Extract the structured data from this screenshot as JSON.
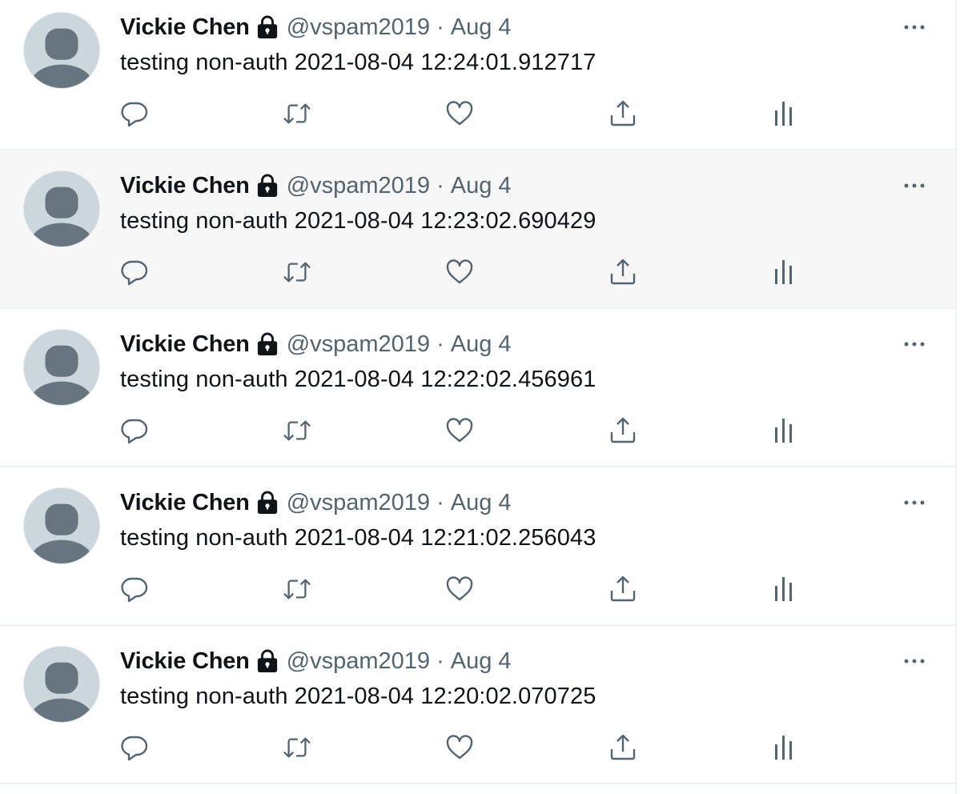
{
  "tweets": [
    {
      "name": "Vickie Chen",
      "handle": "@vspam2019",
      "separator": "·",
      "date": "Aug 4",
      "text": "testing non-auth 2021-08-04 12:24:01.912717",
      "hovered": false
    },
    {
      "name": "Vickie Chen",
      "handle": "@vspam2019",
      "separator": "·",
      "date": "Aug 4",
      "text": "testing non-auth 2021-08-04 12:23:02.690429",
      "hovered": true
    },
    {
      "name": "Vickie Chen",
      "handle": "@vspam2019",
      "separator": "·",
      "date": "Aug 4",
      "text": "testing non-auth 2021-08-04 12:22:02.456961",
      "hovered": false
    },
    {
      "name": "Vickie Chen",
      "handle": "@vspam2019",
      "separator": "·",
      "date": "Aug 4",
      "text": "testing non-auth 2021-08-04 12:21:02.256043",
      "hovered": false
    },
    {
      "name": "Vickie Chen",
      "handle": "@vspam2019",
      "separator": "·",
      "date": "Aug 4",
      "text": "testing non-auth 2021-08-04 12:20:02.070725",
      "hovered": false
    }
  ],
  "icons": {
    "protected": "lock-icon",
    "more": "more-icon",
    "reply": "reply-icon",
    "retweet": "retweet-icon",
    "like": "like-icon",
    "share": "share-icon",
    "analytics": "analytics-icon"
  },
  "colors": {
    "name": "#0f1419",
    "secondary": "#536471",
    "hover_bg": "#f7f7f7",
    "avatar_bg": "#ccd6dd",
    "avatar_figure": "#66757f",
    "divider": "#eff3f4"
  }
}
